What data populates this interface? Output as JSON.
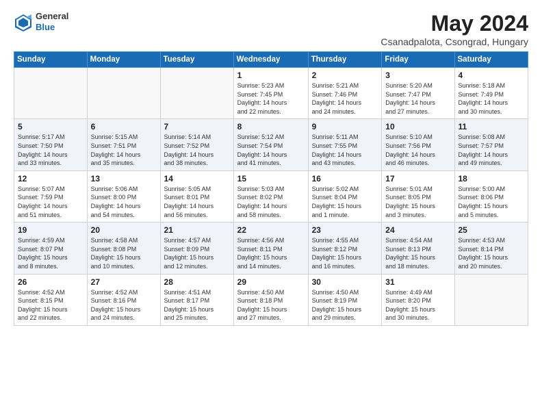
{
  "header": {
    "logo_general": "General",
    "logo_blue": "Blue",
    "month": "May 2024",
    "location": "Csanadpalota, Csongrad, Hungary"
  },
  "weekdays": [
    "Sunday",
    "Monday",
    "Tuesday",
    "Wednesday",
    "Thursday",
    "Friday",
    "Saturday"
  ],
  "weeks": [
    [
      {
        "day": "",
        "info": ""
      },
      {
        "day": "",
        "info": ""
      },
      {
        "day": "",
        "info": ""
      },
      {
        "day": "1",
        "info": "Sunrise: 5:23 AM\nSunset: 7:45 PM\nDaylight: 14 hours\nand 22 minutes."
      },
      {
        "day": "2",
        "info": "Sunrise: 5:21 AM\nSunset: 7:46 PM\nDaylight: 14 hours\nand 24 minutes."
      },
      {
        "day": "3",
        "info": "Sunrise: 5:20 AM\nSunset: 7:47 PM\nDaylight: 14 hours\nand 27 minutes."
      },
      {
        "day": "4",
        "info": "Sunrise: 5:18 AM\nSunset: 7:49 PM\nDaylight: 14 hours\nand 30 minutes."
      }
    ],
    [
      {
        "day": "5",
        "info": "Sunrise: 5:17 AM\nSunset: 7:50 PM\nDaylight: 14 hours\nand 33 minutes."
      },
      {
        "day": "6",
        "info": "Sunrise: 5:15 AM\nSunset: 7:51 PM\nDaylight: 14 hours\nand 35 minutes."
      },
      {
        "day": "7",
        "info": "Sunrise: 5:14 AM\nSunset: 7:52 PM\nDaylight: 14 hours\nand 38 minutes."
      },
      {
        "day": "8",
        "info": "Sunrise: 5:12 AM\nSunset: 7:54 PM\nDaylight: 14 hours\nand 41 minutes."
      },
      {
        "day": "9",
        "info": "Sunrise: 5:11 AM\nSunset: 7:55 PM\nDaylight: 14 hours\nand 43 minutes."
      },
      {
        "day": "10",
        "info": "Sunrise: 5:10 AM\nSunset: 7:56 PM\nDaylight: 14 hours\nand 46 minutes."
      },
      {
        "day": "11",
        "info": "Sunrise: 5:08 AM\nSunset: 7:57 PM\nDaylight: 14 hours\nand 49 minutes."
      }
    ],
    [
      {
        "day": "12",
        "info": "Sunrise: 5:07 AM\nSunset: 7:59 PM\nDaylight: 14 hours\nand 51 minutes."
      },
      {
        "day": "13",
        "info": "Sunrise: 5:06 AM\nSunset: 8:00 PM\nDaylight: 14 hours\nand 54 minutes."
      },
      {
        "day": "14",
        "info": "Sunrise: 5:05 AM\nSunset: 8:01 PM\nDaylight: 14 hours\nand 56 minutes."
      },
      {
        "day": "15",
        "info": "Sunrise: 5:03 AM\nSunset: 8:02 PM\nDaylight: 14 hours\nand 58 minutes."
      },
      {
        "day": "16",
        "info": "Sunrise: 5:02 AM\nSunset: 8:04 PM\nDaylight: 15 hours\nand 1 minute."
      },
      {
        "day": "17",
        "info": "Sunrise: 5:01 AM\nSunset: 8:05 PM\nDaylight: 15 hours\nand 3 minutes."
      },
      {
        "day": "18",
        "info": "Sunrise: 5:00 AM\nSunset: 8:06 PM\nDaylight: 15 hours\nand 5 minutes."
      }
    ],
    [
      {
        "day": "19",
        "info": "Sunrise: 4:59 AM\nSunset: 8:07 PM\nDaylight: 15 hours\nand 8 minutes."
      },
      {
        "day": "20",
        "info": "Sunrise: 4:58 AM\nSunset: 8:08 PM\nDaylight: 15 hours\nand 10 minutes."
      },
      {
        "day": "21",
        "info": "Sunrise: 4:57 AM\nSunset: 8:09 PM\nDaylight: 15 hours\nand 12 minutes."
      },
      {
        "day": "22",
        "info": "Sunrise: 4:56 AM\nSunset: 8:11 PM\nDaylight: 15 hours\nand 14 minutes."
      },
      {
        "day": "23",
        "info": "Sunrise: 4:55 AM\nSunset: 8:12 PM\nDaylight: 15 hours\nand 16 minutes."
      },
      {
        "day": "24",
        "info": "Sunrise: 4:54 AM\nSunset: 8:13 PM\nDaylight: 15 hours\nand 18 minutes."
      },
      {
        "day": "25",
        "info": "Sunrise: 4:53 AM\nSunset: 8:14 PM\nDaylight: 15 hours\nand 20 minutes."
      }
    ],
    [
      {
        "day": "26",
        "info": "Sunrise: 4:52 AM\nSunset: 8:15 PM\nDaylight: 15 hours\nand 22 minutes."
      },
      {
        "day": "27",
        "info": "Sunrise: 4:52 AM\nSunset: 8:16 PM\nDaylight: 15 hours\nand 24 minutes."
      },
      {
        "day": "28",
        "info": "Sunrise: 4:51 AM\nSunset: 8:17 PM\nDaylight: 15 hours\nand 25 minutes."
      },
      {
        "day": "29",
        "info": "Sunrise: 4:50 AM\nSunset: 8:18 PM\nDaylight: 15 hours\nand 27 minutes."
      },
      {
        "day": "30",
        "info": "Sunrise: 4:50 AM\nSunset: 8:19 PM\nDaylight: 15 hours\nand 29 minutes."
      },
      {
        "day": "31",
        "info": "Sunrise: 4:49 AM\nSunset: 8:20 PM\nDaylight: 15 hours\nand 30 minutes."
      },
      {
        "day": "",
        "info": ""
      }
    ]
  ]
}
